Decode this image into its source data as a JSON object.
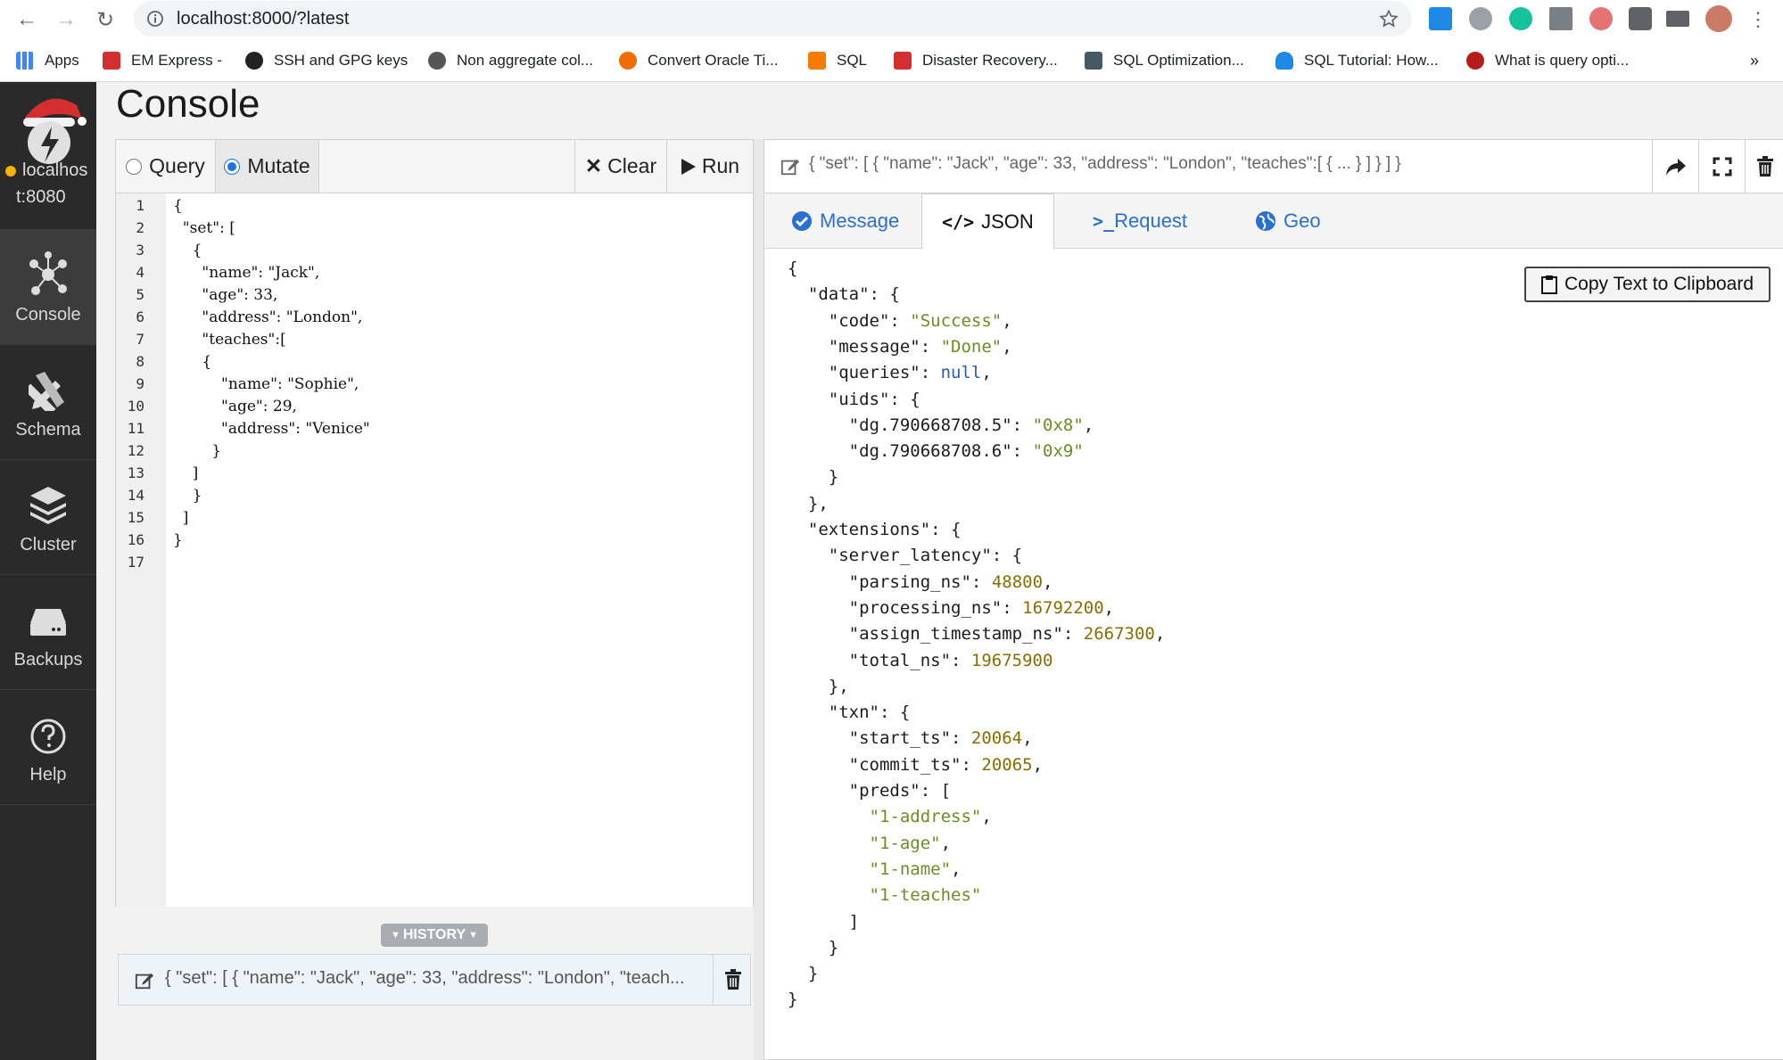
{
  "browser": {
    "url": "localhost:8000/?latest",
    "bookmarks": [
      {
        "label": "Apps"
      },
      {
        "label": "EM Express -"
      },
      {
        "label": "SSH and GPG keys"
      },
      {
        "label": "Non aggregate col..."
      },
      {
        "label": "Convert Oracle Ti..."
      },
      {
        "label": "SQL"
      },
      {
        "label": "Disaster Recovery..."
      },
      {
        "label": "SQL Optimization..."
      },
      {
        "label": "SQL Tutorial: How..."
      },
      {
        "label": "What is query opti..."
      }
    ],
    "more": "»"
  },
  "sidebar": {
    "server_line1": "localhos",
    "server_line2": "t:8080",
    "items": [
      {
        "label": "Console"
      },
      {
        "label": "Schema"
      },
      {
        "label": "Cluster"
      },
      {
        "label": "Backups"
      },
      {
        "label": "Help"
      }
    ]
  },
  "page": {
    "title": "Console"
  },
  "editor": {
    "mode_query": "Query",
    "mode_mutate": "Mutate",
    "selected_mode": "Mutate",
    "clear_label": "Clear",
    "run_label": "Run",
    "lines": [
      "{",
      "  \"set\": [",
      "    {",
      "      \"name\": \"Jack\",",
      "      \"age\": 33,",
      "      \"address\": \"London\",",
      "      \"teaches\":[",
      "      {",
      "          \"name\": \"Sophie\",",
      "          \"age\": 29,",
      "          \"address\": \"Venice\"",
      "        }",
      "    ]",
      "    }",
      "  ]",
      "}",
      ""
    ]
  },
  "history": {
    "tab_label": "HISTORY",
    "entry": "{ \"set\": [ { \"name\": \"Jack\", \"age\": 33, \"address\": \"London\", \"teach..."
  },
  "result": {
    "query_summary": "{ \"set\": [ { \"name\": \"Jack\", \"age\": 33, \"address\": \"London\", \"teaches\":[ { ... } ] } ] }",
    "tabs": [
      {
        "label": "Message"
      },
      {
        "label": "JSON"
      },
      {
        "label": "Request"
      },
      {
        "label": "Geo"
      }
    ],
    "active_tab": "JSON",
    "copy_label": "Copy Text to Clipboard",
    "json_lines": [
      "{",
      "  \"data\": {",
      "    \"code\": \"Success\",",
      "    \"message\": \"Done\",",
      "    \"queries\": null,",
      "    \"uids\": {",
      "      \"dg.790668708.5\": \"0x8\",",
      "      \"dg.790668708.6\": \"0x9\"",
      "    }",
      "  },",
      "  \"extensions\": {",
      "    \"server_latency\": {",
      "      \"parsing_ns\": 48800,",
      "      \"processing_ns\": 16792200,",
      "      \"assign_timestamp_ns\": 2667300,",
      "      \"total_ns\": 19675900",
      "    },",
      "    \"txn\": {",
      "      \"start_ts\": 20064,",
      "      \"commit_ts\": 20065,",
      "      \"preds\": [",
      "        \"1-address\",",
      "        \"1-age\",",
      "        \"1-name\",",
      "        \"1-teaches\"",
      "      ]",
      "    }",
      "  }",
      "}"
    ]
  },
  "colors": {
    "sidebar_bg": "#2a2a2a",
    "accent_blue": "#2a6fd6",
    "json_string": "#6b8e23",
    "json_number": "#8a6d00",
    "status_dot": "#f4b400"
  }
}
